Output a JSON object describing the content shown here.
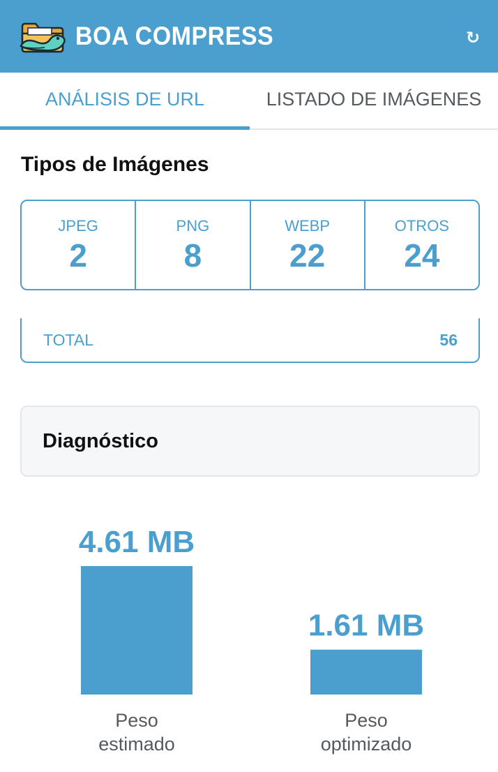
{
  "header": {
    "title": "BOA COMPRESS",
    "refresh_icon": "refresh-icon",
    "background": "#4a9fce"
  },
  "tabs": [
    {
      "label": "ANÁLISIS DE URL",
      "active": true
    },
    {
      "label": "LISTADO DE IMÁGENES",
      "active": false
    }
  ],
  "image_types": {
    "title": "Tipos de Imágenes",
    "items": [
      {
        "label": "JPEG",
        "count": "2"
      },
      {
        "label": "PNG",
        "count": "8"
      },
      {
        "label": "WEBP",
        "count": "22"
      },
      {
        "label": "OTROS",
        "count": "24"
      }
    ],
    "total_label": "TOTAL",
    "total_value": "56"
  },
  "diagnostic": {
    "title": "Diagnóstico"
  },
  "chart_data": {
    "type": "bar",
    "categories": [
      "Peso estimado",
      "Peso optimizado"
    ],
    "values": [
      4.61,
      1.61
    ],
    "value_labels": [
      "4.61 MB",
      "1.61 MB"
    ],
    "caption_lines": [
      [
        "Peso",
        "estimado"
      ],
      [
        "Peso",
        "optimizado"
      ]
    ],
    "unit": "MB",
    "color": "#4a9fce",
    "label_color": "#4a9fce"
  }
}
